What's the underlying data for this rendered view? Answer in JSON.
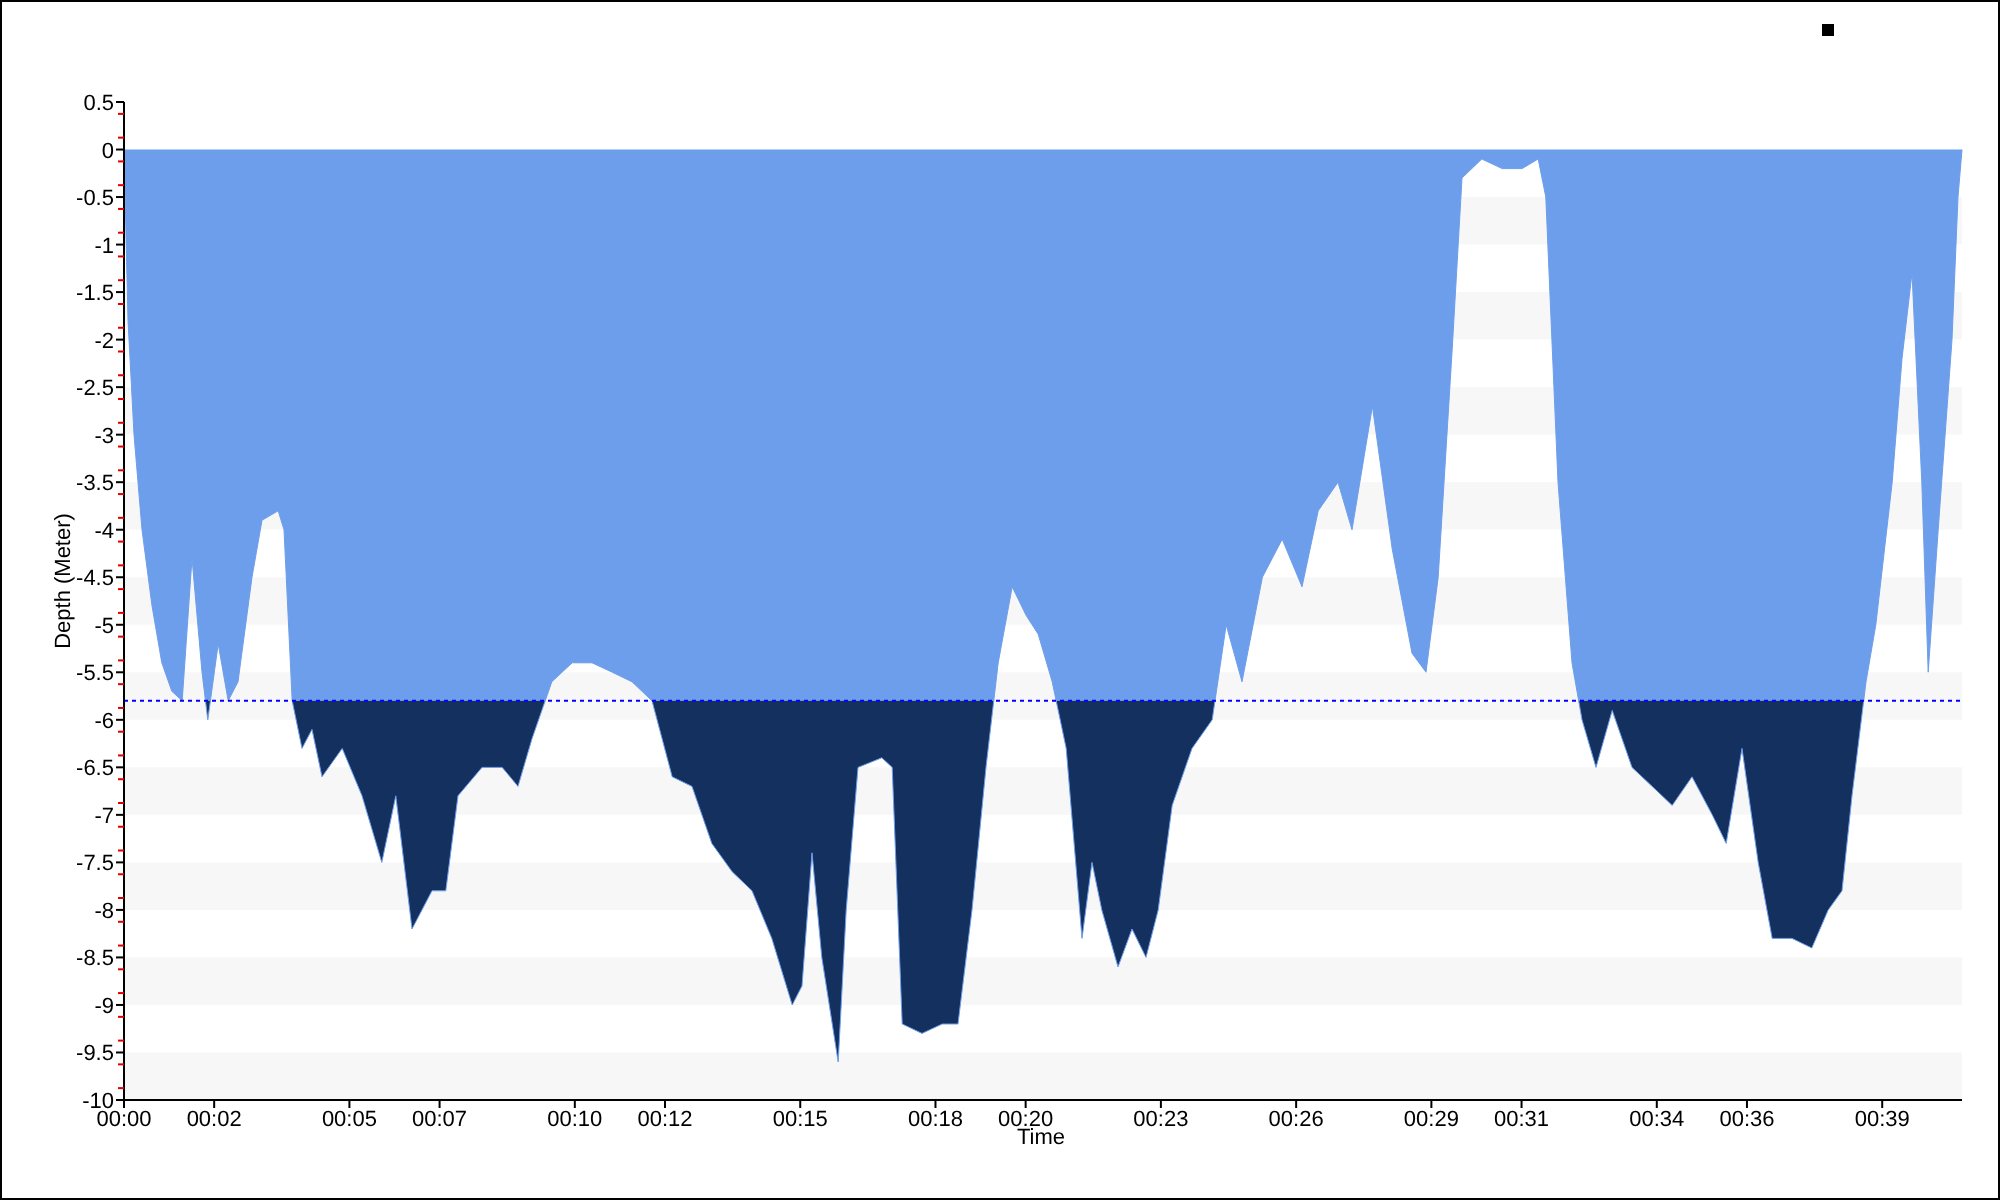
{
  "legend": {
    "marker": true
  },
  "chart_data": {
    "type": "area",
    "xlabel": "Time",
    "ylabel": "Depth (Meter)",
    "xlim": [
      0,
      40.77
    ],
    "ylim": [
      -10,
      0.5
    ],
    "xticks": [
      {
        "value": 0,
        "label": "00:00"
      },
      {
        "value": 2,
        "label": "00:02"
      },
      {
        "value": 5,
        "label": "00:05"
      },
      {
        "value": 7,
        "label": "00:07"
      },
      {
        "value": 10,
        "label": "00:10"
      },
      {
        "value": 12,
        "label": "00:12"
      },
      {
        "value": 15,
        "label": "00:15"
      },
      {
        "value": 18,
        "label": "00:18"
      },
      {
        "value": 20,
        "label": "00:20"
      },
      {
        "value": 23,
        "label": "00:23"
      },
      {
        "value": 26,
        "label": "00:26"
      },
      {
        "value": 29,
        "label": "00:29"
      },
      {
        "value": 31,
        "label": "00:31"
      },
      {
        "value": 34,
        "label": "00:34"
      },
      {
        "value": 36,
        "label": "00:36"
      },
      {
        "value": 39,
        "label": "00:39"
      }
    ],
    "yticks": [
      0.5,
      0,
      -0.5,
      -1,
      -1.5,
      -2,
      -2.5,
      -3,
      -3.5,
      -4,
      -4.5,
      -5,
      -5.5,
      -6,
      -6.5,
      -7,
      -7.5,
      -8,
      -8.5,
      -9,
      -9.5,
      -10
    ],
    "x": [
      0,
      0.09,
      0.22,
      0.4,
      0.62,
      0.84,
      1.06,
      1.29,
      1.51,
      1.73,
      1.86,
      2.09,
      2.31,
      2.53,
      2.84,
      3.06,
      3.42,
      3.55,
      3.73,
      3.95,
      4.17,
      4.39,
      4.84,
      5.28,
      5.72,
      6.03,
      6.39,
      6.83,
      7.14,
      7.41,
      7.94,
      8.39,
      8.74,
      9.05,
      9.49,
      9.94,
      10.38,
      10.83,
      11.27,
      11.71,
      12.16,
      12.6,
      13.04,
      13.49,
      13.93,
      14.37,
      14.82,
      15.04,
      15.26,
      15.48,
      15.84,
      16.02,
      16.28,
      16.81,
      17.04,
      17.26,
      17.7,
      18.15,
      18.5,
      18.81,
      19.12,
      19.39,
      19.7,
      20.01,
      20.28,
      20.59,
      20.9,
      21.25,
      21.47,
      21.69,
      22.05,
      22.36,
      22.67,
      22.94,
      23.25,
      23.69,
      24.14,
      24.45,
      24.8,
      25.25,
      25.69,
      26.13,
      26.49,
      26.93,
      27.24,
      27.69,
      28.13,
      28.57,
      28.88,
      29.15,
      29.46,
      29.68,
      30.12,
      30.57,
      31.01,
      31.37,
      31.54,
      31.81,
      32.12,
      32.34,
      32.65,
      33.01,
      33.45,
      33.9,
      34.34,
      34.78,
      35.23,
      35.54,
      35.89,
      36.25,
      36.56,
      37,
      37.44,
      37.8,
      38.11,
      38.33,
      38.64,
      38.86,
      39.22,
      39.44,
      39.66,
      39.88,
      40.02,
      40.24,
      40.55,
      40.68,
      40.77
    ],
    "series": [
      {
        "color": "#6d9eeb",
        "values": [
          0,
          -1.8,
          -3,
          -4,
          -4.8,
          -5.4,
          -5.7,
          -5.8,
          -4.3,
          -5.5,
          -6,
          -5.2,
          -5.8,
          -5.6,
          -4.5,
          -3.9,
          -3.8,
          -4,
          -5.8,
          -6.3,
          -6.1,
          -6.6,
          -6.3,
          -6.8,
          -7.5,
          -6.8,
          -8.2,
          -7.8,
          -7.8,
          -6.8,
          -6.5,
          -6.5,
          -6.7,
          -6.2,
          -5.6,
          -5.4,
          -5.4,
          -5.5,
          -5.6,
          -5.8,
          -6.6,
          -6.7,
          -7.3,
          -7.6,
          -7.8,
          -8.3,
          -9,
          -8.8,
          -7.4,
          -8.5,
          -9.6,
          -8,
          -6.5,
          -6.4,
          -6.5,
          -9.2,
          -9.3,
          -9.2,
          -9.2,
          -8,
          -6.5,
          -5.4,
          -4.6,
          -4.9,
          -5.1,
          -5.6,
          -6.3,
          -8.3,
          -7.5,
          -8,
          -8.6,
          -8.2,
          -8.5,
          -8,
          -6.9,
          -6.3,
          -6,
          -5,
          -5.6,
          -4.5,
          -4.1,
          -4.6,
          -3.8,
          -3.5,
          -4,
          -2.7,
          -4.2,
          -5.3,
          -5.5,
          -4.5,
          -2.1,
          -0.3,
          -0.1,
          -0.2,
          -0.2,
          -0.1,
          -0.5,
          -3.5,
          -5.4,
          -6,
          -6.5,
          -5.9,
          -6.5,
          -6.7,
          -6.9,
          -6.6,
          -7,
          -7.3,
          -6.3,
          -7.5,
          -8.3,
          -8.3,
          -8.4,
          -8,
          -7.8,
          -6.8,
          -5.6,
          -5,
          -3.5,
          -2.2,
          -1.3,
          -3.5,
          -5.5,
          -4,
          -2,
          -0.5,
          0
        ]
      }
    ],
    "ref_lines": [
      {
        "axis": "y",
        "value": -5.8,
        "color": "#0000ff"
      }
    ]
  }
}
